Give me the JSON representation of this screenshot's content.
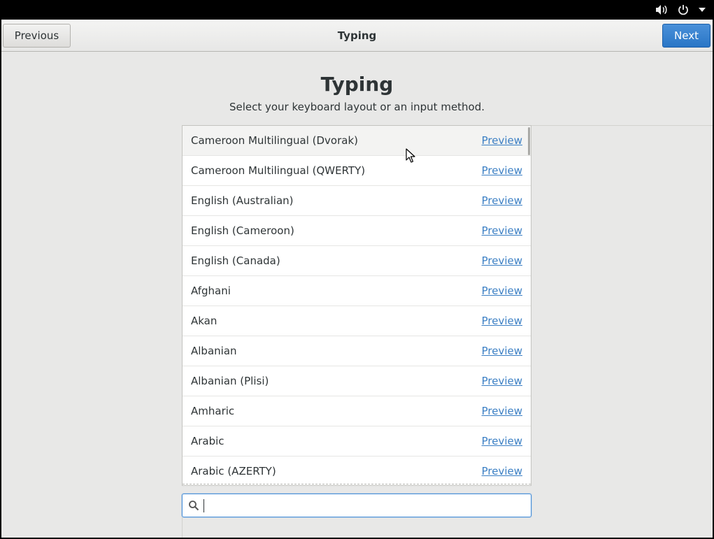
{
  "header": {
    "previous_label": "Previous",
    "title": "Typing",
    "next_label": "Next"
  },
  "main": {
    "title": "Typing",
    "subtitle": "Select your keyboard layout or an input method."
  },
  "layouts": [
    {
      "name": "Cameroon Multilingual (Dvorak)",
      "preview": "Preview"
    },
    {
      "name": "Cameroon Multilingual (QWERTY)",
      "preview": "Preview"
    },
    {
      "name": "English (Australian)",
      "preview": "Preview"
    },
    {
      "name": "English (Cameroon)",
      "preview": "Preview"
    },
    {
      "name": "English (Canada)",
      "preview": "Preview"
    },
    {
      "name": "Afghani",
      "preview": "Preview"
    },
    {
      "name": "Akan",
      "preview": "Preview"
    },
    {
      "name": "Albanian",
      "preview": "Preview"
    },
    {
      "name": "Albanian (Plisi)",
      "preview": "Preview"
    },
    {
      "name": "Amharic",
      "preview": "Preview"
    },
    {
      "name": "Arabic",
      "preview": "Preview"
    },
    {
      "name": "Arabic (AZERTY)",
      "preview": "Preview"
    }
  ],
  "search": {
    "value": "",
    "icon": "search-icon"
  },
  "system_tray": {
    "icons": [
      "volume-icon",
      "power-icon",
      "chevron-down-icon"
    ]
  },
  "colors": {
    "accent": "#4a90d9",
    "link": "#3b7fc4"
  }
}
